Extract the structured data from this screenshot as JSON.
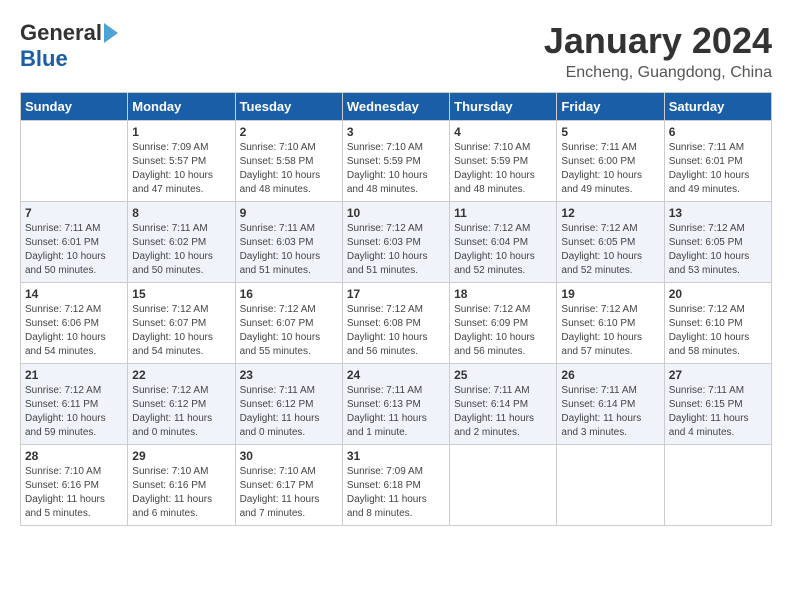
{
  "header": {
    "logo_general": "General",
    "logo_blue": "Blue",
    "month_title": "January 2024",
    "location": "Encheng, Guangdong, China"
  },
  "days_of_week": [
    "Sunday",
    "Monday",
    "Tuesday",
    "Wednesday",
    "Thursday",
    "Friday",
    "Saturday"
  ],
  "weeks": [
    [
      {
        "day": "",
        "info": ""
      },
      {
        "day": "1",
        "info": "Sunrise: 7:09 AM\nSunset: 5:57 PM\nDaylight: 10 hours\nand 47 minutes."
      },
      {
        "day": "2",
        "info": "Sunrise: 7:10 AM\nSunset: 5:58 PM\nDaylight: 10 hours\nand 48 minutes."
      },
      {
        "day": "3",
        "info": "Sunrise: 7:10 AM\nSunset: 5:59 PM\nDaylight: 10 hours\nand 48 minutes."
      },
      {
        "day": "4",
        "info": "Sunrise: 7:10 AM\nSunset: 5:59 PM\nDaylight: 10 hours\nand 48 minutes."
      },
      {
        "day": "5",
        "info": "Sunrise: 7:11 AM\nSunset: 6:00 PM\nDaylight: 10 hours\nand 49 minutes."
      },
      {
        "day": "6",
        "info": "Sunrise: 7:11 AM\nSunset: 6:01 PM\nDaylight: 10 hours\nand 49 minutes."
      }
    ],
    [
      {
        "day": "7",
        "info": "Sunrise: 7:11 AM\nSunset: 6:01 PM\nDaylight: 10 hours\nand 50 minutes."
      },
      {
        "day": "8",
        "info": "Sunrise: 7:11 AM\nSunset: 6:02 PM\nDaylight: 10 hours\nand 50 minutes."
      },
      {
        "day": "9",
        "info": "Sunrise: 7:11 AM\nSunset: 6:03 PM\nDaylight: 10 hours\nand 51 minutes."
      },
      {
        "day": "10",
        "info": "Sunrise: 7:12 AM\nSunset: 6:03 PM\nDaylight: 10 hours\nand 51 minutes."
      },
      {
        "day": "11",
        "info": "Sunrise: 7:12 AM\nSunset: 6:04 PM\nDaylight: 10 hours\nand 52 minutes."
      },
      {
        "day": "12",
        "info": "Sunrise: 7:12 AM\nSunset: 6:05 PM\nDaylight: 10 hours\nand 52 minutes."
      },
      {
        "day": "13",
        "info": "Sunrise: 7:12 AM\nSunset: 6:05 PM\nDaylight: 10 hours\nand 53 minutes."
      }
    ],
    [
      {
        "day": "14",
        "info": "Sunrise: 7:12 AM\nSunset: 6:06 PM\nDaylight: 10 hours\nand 54 minutes."
      },
      {
        "day": "15",
        "info": "Sunrise: 7:12 AM\nSunset: 6:07 PM\nDaylight: 10 hours\nand 54 minutes."
      },
      {
        "day": "16",
        "info": "Sunrise: 7:12 AM\nSunset: 6:07 PM\nDaylight: 10 hours\nand 55 minutes."
      },
      {
        "day": "17",
        "info": "Sunrise: 7:12 AM\nSunset: 6:08 PM\nDaylight: 10 hours\nand 56 minutes."
      },
      {
        "day": "18",
        "info": "Sunrise: 7:12 AM\nSunset: 6:09 PM\nDaylight: 10 hours\nand 56 minutes."
      },
      {
        "day": "19",
        "info": "Sunrise: 7:12 AM\nSunset: 6:10 PM\nDaylight: 10 hours\nand 57 minutes."
      },
      {
        "day": "20",
        "info": "Sunrise: 7:12 AM\nSunset: 6:10 PM\nDaylight: 10 hours\nand 58 minutes."
      }
    ],
    [
      {
        "day": "21",
        "info": "Sunrise: 7:12 AM\nSunset: 6:11 PM\nDaylight: 10 hours\nand 59 minutes."
      },
      {
        "day": "22",
        "info": "Sunrise: 7:12 AM\nSunset: 6:12 PM\nDaylight: 11 hours\nand 0 minutes."
      },
      {
        "day": "23",
        "info": "Sunrise: 7:11 AM\nSunset: 6:12 PM\nDaylight: 11 hours\nand 0 minutes."
      },
      {
        "day": "24",
        "info": "Sunrise: 7:11 AM\nSunset: 6:13 PM\nDaylight: 11 hours\nand 1 minute."
      },
      {
        "day": "25",
        "info": "Sunrise: 7:11 AM\nSunset: 6:14 PM\nDaylight: 11 hours\nand 2 minutes."
      },
      {
        "day": "26",
        "info": "Sunrise: 7:11 AM\nSunset: 6:14 PM\nDaylight: 11 hours\nand 3 minutes."
      },
      {
        "day": "27",
        "info": "Sunrise: 7:11 AM\nSunset: 6:15 PM\nDaylight: 11 hours\nand 4 minutes."
      }
    ],
    [
      {
        "day": "28",
        "info": "Sunrise: 7:10 AM\nSunset: 6:16 PM\nDaylight: 11 hours\nand 5 minutes."
      },
      {
        "day": "29",
        "info": "Sunrise: 7:10 AM\nSunset: 6:16 PM\nDaylight: 11 hours\nand 6 minutes."
      },
      {
        "day": "30",
        "info": "Sunrise: 7:10 AM\nSunset: 6:17 PM\nDaylight: 11 hours\nand 7 minutes."
      },
      {
        "day": "31",
        "info": "Sunrise: 7:09 AM\nSunset: 6:18 PM\nDaylight: 11 hours\nand 8 minutes."
      },
      {
        "day": "",
        "info": ""
      },
      {
        "day": "",
        "info": ""
      },
      {
        "day": "",
        "info": ""
      }
    ]
  ]
}
